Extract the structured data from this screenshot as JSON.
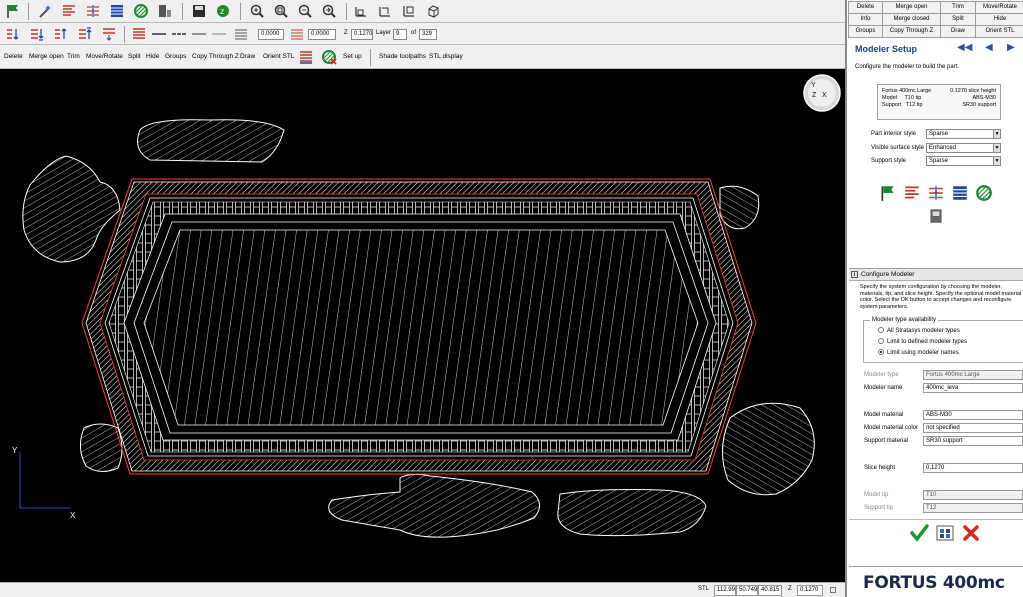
{
  "toolbar3": {
    "delete": "Delete",
    "merge_open": "Merge open",
    "trim": "Trim",
    "move_rotate": "Move/Rotate",
    "split": "Split",
    "hide": "Hide",
    "groups": "Groups",
    "copy_through_z": "Copy Through Z",
    "draw": "Draw",
    "orient_stl": "Orient STL",
    "set_up": "Set up",
    "shade_toolpaths": "Shade toolpaths",
    "stl_display": "STL display"
  },
  "toolbar2": {
    "offset1": "0.0000",
    "offset2": "0.0000",
    "z_label": "Z",
    "z_value": "0.1270",
    "layer_label": "Layer",
    "layer_value": "9",
    "of_label": "of",
    "layer_total": "329"
  },
  "canvas": {
    "gizmo_y": "Y",
    "gizmo_z": "Z",
    "gizmo_x": "X",
    "axis_y": "Y",
    "axis_x": "X",
    "colors": {
      "background": "#000000",
      "outline": "#ffffff",
      "boundary": "#ff3b30"
    }
  },
  "status": {
    "unit": "STL",
    "x": "112.99",
    "y": "50.749",
    "z": "40.815",
    "z_label": "Z",
    "z_value": "0.1270"
  },
  "commands": [
    "Delete",
    "Merge open",
    "Trim",
    "Move/Rotate",
    "Info",
    "Merge closed",
    "Split",
    "Hide",
    "Groups",
    "Copy Through Z",
    "Draw",
    "Orient STL"
  ],
  "setup": {
    "title": "Modeler Setup",
    "description": "Configure the modeler to build the part.",
    "summary": {
      "line1_left": "Fortus 400mc Large",
      "line1_right": "0.1270 slice height",
      "line2_left": "Model     T10 tip",
      "line2_right": "ABS-M30",
      "line3_left": "Support   T12 tip",
      "line3_right": "SR30 support"
    },
    "params": [
      {
        "label": "Part interior style",
        "value": "Sparse"
      },
      {
        "label": "Visible surface style",
        "value": "Enhanced"
      },
      {
        "label": "Support style",
        "value": "Sparse"
      }
    ]
  },
  "configure": {
    "title": "Configure Modeler",
    "description": "Specify the system configuration by choosing the modeler, materials, tip, and slice height. Specify the optional model material color. Select the OK button to accept changes and reconfigure system parameters.",
    "availability_legend": "Modeler type availability",
    "options": [
      "All Stratasys modeler types",
      "Limit to defined modeler types",
      "Limit using modeler names"
    ],
    "selected_option": 2,
    "fields": {
      "modeler_type_label": "Modeler type",
      "modeler_type": "Fortus 400mc Large",
      "modeler_name_label": "Modeler name",
      "modeler_name": "400mc_leva",
      "model_material_label": "Model material",
      "model_material": "ABS-M30",
      "model_color_label": "Model material color",
      "model_color": "not specified",
      "support_material_label": "Support material",
      "support_material": "SR30 support",
      "slice_height_label": "Slice height",
      "slice_height": "0.1270",
      "model_tip_label": "Model tip",
      "model_tip": "T10",
      "support_tip_label": "Support tip",
      "support_tip": "T12"
    }
  },
  "brand": {
    "name": "FORTUS",
    "model": "400mc"
  }
}
